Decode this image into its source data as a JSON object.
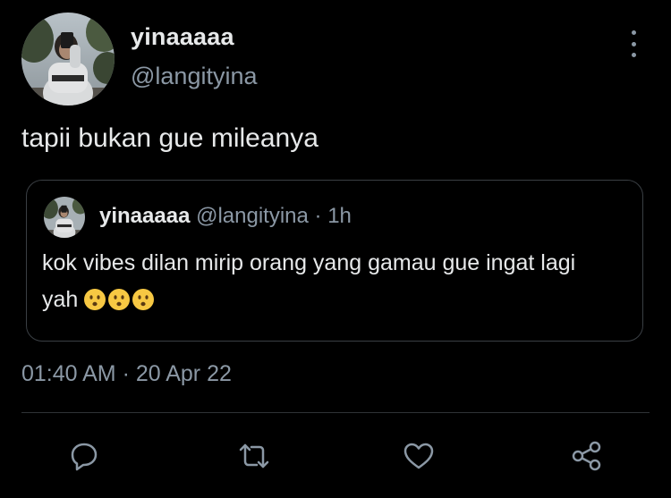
{
  "author": {
    "display_name": "yinaaaaa",
    "handle": "@langityina",
    "avatar_icon": "profile-photo-avatar"
  },
  "tweet": {
    "text": "tapii bukan gue mileanya",
    "timestamp": "01:40 AM · 20 Apr 22"
  },
  "quoted_tweet": {
    "display_name": "yinaaaaa",
    "handle": "@langityina",
    "separator": "·",
    "age": "1h",
    "text": "kok vibes dilan mirip orang yang gamau gue ingat lagi yah",
    "emojis": [
      "hushed-face",
      "hushed-face",
      "hushed-face"
    ]
  },
  "actions": [
    "reply-icon",
    "retweet-icon",
    "like-icon",
    "share-icon"
  ],
  "colors": {
    "background": "#000000",
    "text": "#e7e9ea",
    "muted": "#8b98a5",
    "border": "#3a3f44",
    "emoji": "#f7c843"
  }
}
